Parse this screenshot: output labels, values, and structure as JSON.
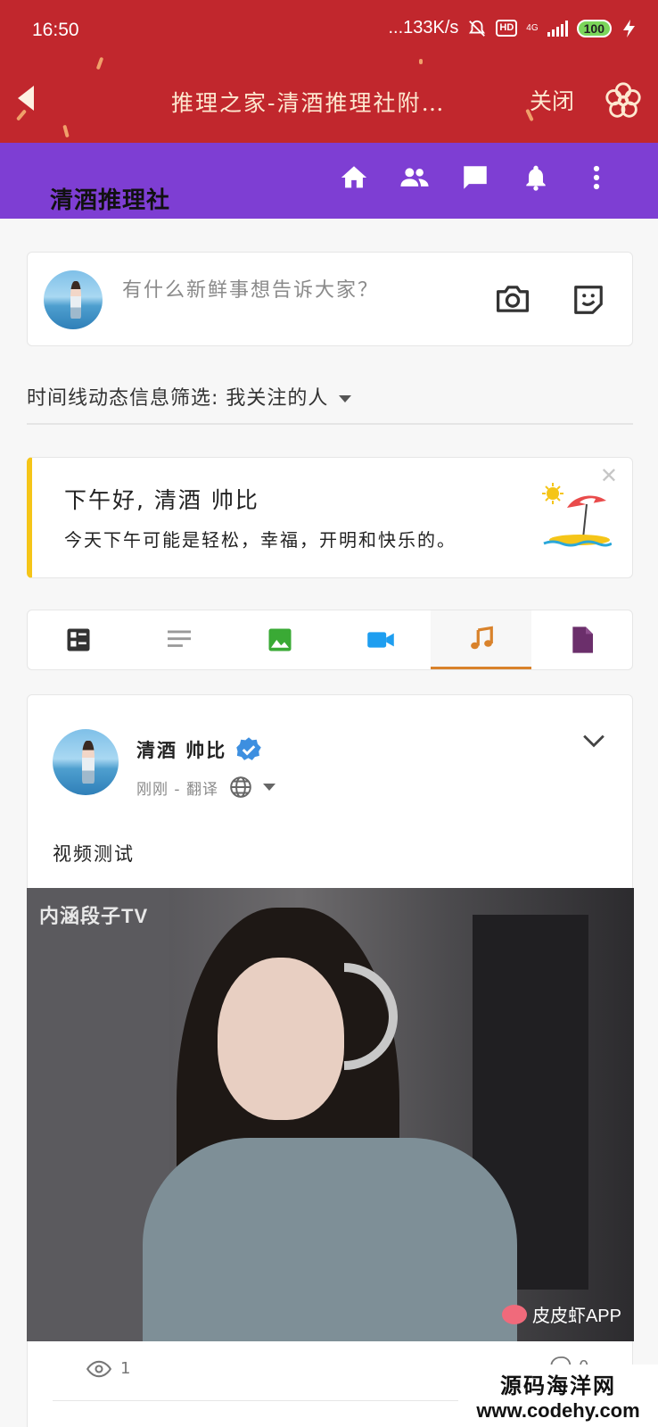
{
  "status_bar": {
    "time": "16:50",
    "net_speed": "...133K/s",
    "hd": "HD",
    "network": "4G",
    "battery": "100"
  },
  "title_bar": {
    "title": "推理之家-清酒推理社附…",
    "close_label": "关闭"
  },
  "nav": {
    "brand": "清酒推理社",
    "icons": [
      "home-icon",
      "people-icon",
      "chat-icon",
      "bell-icon",
      "more-vertical-icon"
    ]
  },
  "composer": {
    "placeholder": "有什么新鲜事想告诉大家？",
    "icons": [
      "camera-icon",
      "sticker-icon"
    ]
  },
  "filter": {
    "label": "时间线动态信息筛选: 我关注的人"
  },
  "greeting": {
    "title": "下午好, 清酒 帅比",
    "text": "今天下午可能是轻松，幸福，开明和快乐的。"
  },
  "post_tabs": {
    "items": [
      "dashboard-icon",
      "text-lines-icon",
      "image-icon",
      "video-camera-icon",
      "music-note-icon",
      "document-icon"
    ],
    "active_index": 4,
    "colors": {
      "dashboard": "#333333",
      "text": "#999999",
      "image": "#3aaa35",
      "video": "#1e9ef0",
      "music": "#d9822b",
      "document": "#6b2f6b"
    }
  },
  "post": {
    "author": "清酒 帅比",
    "verified": true,
    "meta": "刚刚 - 翻译",
    "text": "视频测试",
    "video": {
      "watermark_top": "内涵段子TV",
      "watermark_bottom": "皮皮虾APP"
    },
    "views": "1",
    "comments": "0"
  },
  "site_watermark": {
    "line1": "源码海洋网",
    "line2": "www.codehy.com"
  },
  "colors": {
    "status_red": "#c1272d",
    "nav_purple": "#7e3ed3",
    "accent_yellow": "#f5c518",
    "accent_orange": "#d9822b"
  }
}
